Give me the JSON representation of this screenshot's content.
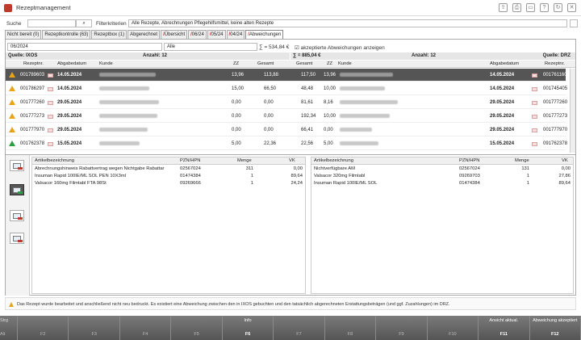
{
  "title": "Rezeptmanagement",
  "search": {
    "label": "Suche",
    "value": "",
    "filter_label": "Filterkriterien",
    "filter_value": "Alle Rezepte, Abrechnungen Pflegehilfsmittel, keine alten Rezepte"
  },
  "tabs": [
    "Nicht bereit (0)",
    "Rezeptkontrolle (63)",
    "Rezeptbox (1)",
    "Abgerechnet",
    "Übersicht",
    "06/24",
    "05/24",
    "04/24",
    "Abweichungen"
  ],
  "filters": {
    "month": "06/2024",
    "scope": "Alle",
    "sum_left": "∑ = 534,84 €",
    "sum_right": "∑ = 885,04 €",
    "checkbox_label": "akzeptierte Abweichungen anzeigen"
  },
  "sources": {
    "left": "Quelle: IXOS",
    "left_count": "Anzahl: 12",
    "right_count": "Anzahl: 12",
    "right": "Quelle: DRZ"
  },
  "columns": {
    "rezeptnr": "Rezeptnr.",
    "abgabedatum": "Abgabedatum",
    "kunde": "Kunde",
    "zz": "ZZ",
    "gesamt": "Gesamt"
  },
  "rows": [
    {
      "status": "warn",
      "nr": "001789603",
      "date": "14.05.2024",
      "zz": "13,96",
      "gesamt": "113,88",
      "r_gesamt": "117,50",
      "r_zz": "13,96",
      "r_date": "14.05.2024",
      "r_nr": "001761160"
    },
    {
      "status": "warn",
      "nr": "001786297",
      "date": "14.05.2024",
      "zz": "15,00",
      "gesamt": "66,50",
      "r_gesamt": "48,48",
      "r_zz": "10,00",
      "r_date": "14.05.2024",
      "r_nr": "001745405"
    },
    {
      "status": "warn",
      "nr": "001777260",
      "date": "29.05.2024",
      "zz": "0,00",
      "gesamt": "0,00",
      "r_gesamt": "81,61",
      "r_zz": "8,16",
      "r_date": "29.05.2024",
      "r_nr": "001777260"
    },
    {
      "status": "warn",
      "nr": "001777273",
      "date": "29.05.2024",
      "zz": "0,00",
      "gesamt": "0,00",
      "r_gesamt": "192,34",
      "r_zz": "10,00",
      "r_date": "29.05.2024",
      "r_nr": "001777273"
    },
    {
      "status": "warn",
      "nr": "001777970",
      "date": "29.05.2024",
      "zz": "0,00",
      "gesamt": "0,00",
      "r_gesamt": "66,41",
      "r_zz": "0,00",
      "r_date": "29.05.2024",
      "r_nr": "001777970"
    },
    {
      "status": "ok",
      "nr": "001762378",
      "date": "15.05.2024",
      "zz": "5,00",
      "gesamt": "22,36",
      "r_gesamt": "22,56",
      "r_zz": "5,00",
      "r_date": "15.05.2024",
      "r_nr": "091762378"
    }
  ],
  "article_cols": {
    "name": "Artikelbezeichnung",
    "pzn": "PZN/HPN",
    "menge": "Menge",
    "vk": "VK"
  },
  "left_articles": [
    {
      "name": "Abrechnungshinweis Rabattvertrag wegen Nichtgabe Rabattar",
      "pzn": "02567024",
      "menge": "311",
      "vk": "0,00"
    },
    {
      "name": "Insuman Rapid 100IE/ML SOL PEN 10X3ml",
      "pzn": "01474384",
      "menge": "1",
      "vk": "89,64"
    },
    {
      "name": "Valsacor 160mg Filmtabl FTA 98St",
      "pzn": "09269666",
      "menge": "1",
      "vk": "24,24"
    }
  ],
  "right_articles": [
    {
      "name": "Nichtverfügbare AM",
      "pzn": "02567024",
      "menge": "131",
      "vk": "0,00"
    },
    {
      "name": "Valsacor 320mg Filmtabl",
      "pzn": "09269703",
      "menge": "1",
      "vk": "27,86"
    },
    {
      "name": "Insuman Rapid 100IE/ML SOL",
      "pzn": "01474384",
      "menge": "1",
      "vk": "89,64"
    }
  ],
  "info": "Das Rezept wurde bearbeitet und anschließend nicht neu bedruckt. Es existiert eine Abweichung zwischen den in IXOS gebuchten und den tatsächlich abgerechneten Erstattungsbeträgen (und ggf. Zuzahlungen) im DRZ.",
  "fkeys": [
    {
      "top": "Strg",
      "key": "Alt"
    },
    {
      "top": "",
      "key": "F2"
    },
    {
      "top": "",
      "key": "F3"
    },
    {
      "top": "",
      "key": "F4"
    },
    {
      "top": "",
      "key": "F5"
    },
    {
      "top": "Info",
      "key": "F6"
    },
    {
      "top": "",
      "key": "F7"
    },
    {
      "top": "",
      "key": "F8"
    },
    {
      "top": "",
      "key": "F9"
    },
    {
      "top": "",
      "key": "F10"
    },
    {
      "top": "Ansicht aktual.",
      "key": "F11"
    },
    {
      "top": "Abweichung akzeptiert",
      "key": "F12"
    }
  ]
}
